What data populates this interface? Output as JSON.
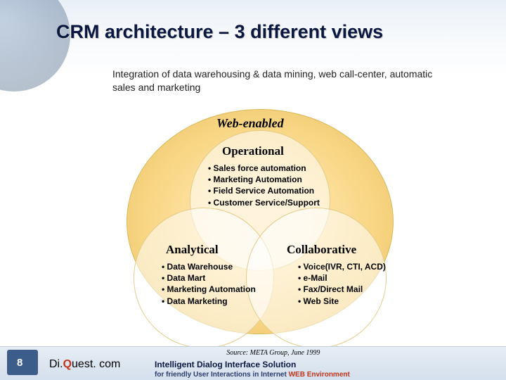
{
  "title": "CRM architecture – 3 different views",
  "subtitle": "Integration of data warehousing & data mining, web call-center, automatic sales and marketing",
  "labels": {
    "web": "Web-enabled",
    "operational": "Operational",
    "analytical": "Analytical",
    "collaborative": "Collaborative"
  },
  "bullets": {
    "operational": [
      "Sales force automation",
      "Marketing Automation",
      "Field Service Automation",
      "Customer Service/Support"
    ],
    "analytical": [
      "Data Warehouse",
      "Data Mart",
      "Marketing Automation",
      "Data Marketing"
    ],
    "collaborative": [
      "Voice(IVR, CTI, ACD)",
      "e-Mail",
      "Fax/Direct Mail",
      "Web Site"
    ]
  },
  "footer": {
    "page": "8",
    "brand_pre": "Di.",
    "brand_q": "Q",
    "brand_post": "uest. com",
    "source": "Source: META Group, June 1999",
    "tag1": "Intelligent Dialog Interface Solution",
    "tag2_a": "for friendly User Interactions in Internet ",
    "tag2_b": "WEB Environment"
  }
}
